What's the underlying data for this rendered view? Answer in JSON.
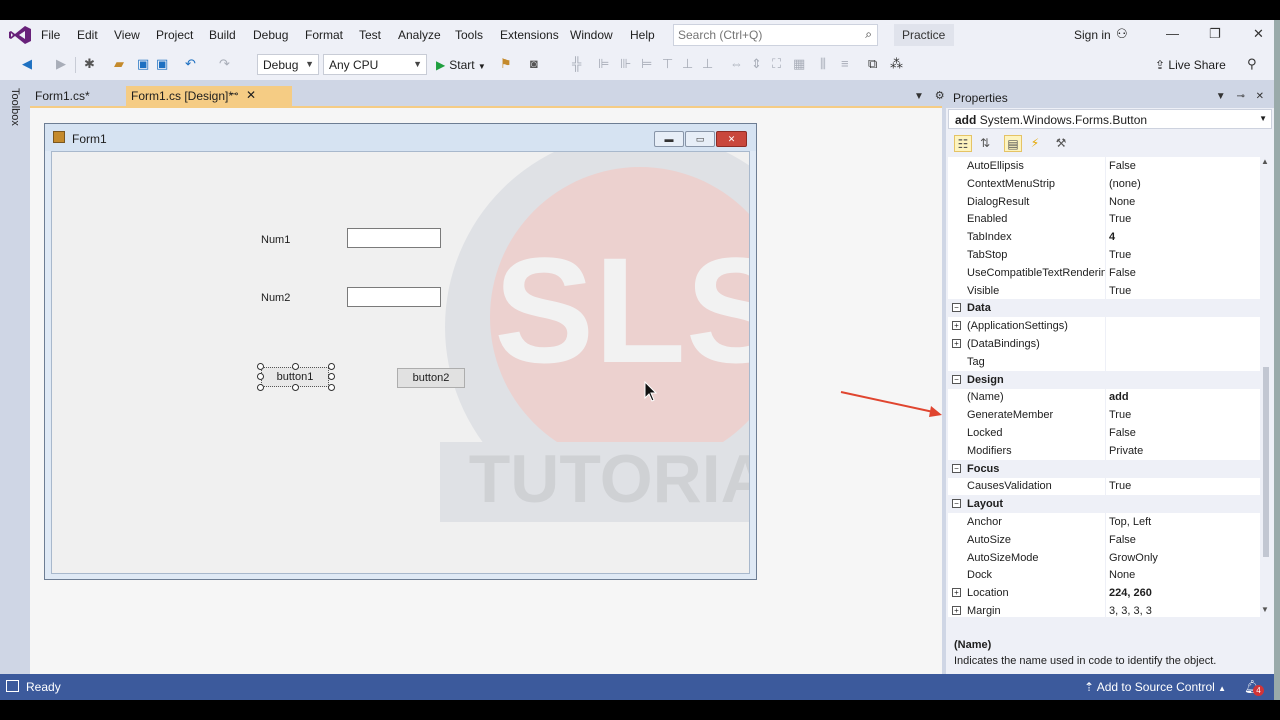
{
  "menu": {
    "items": [
      "File",
      "Edit",
      "View",
      "Project",
      "Build",
      "Debug",
      "Format",
      "Test",
      "Analyze",
      "Tools",
      "Extensions",
      "Window",
      "Help"
    ],
    "search_placeholder": "Search (Ctrl+Q)",
    "solution_name": "Practice",
    "sign_in": "Sign in"
  },
  "toolbar": {
    "config": "Debug",
    "platform": "Any CPU",
    "start": "Start",
    "live_share": "Live Share"
  },
  "toolbox_label": "Toolbox",
  "tabs": [
    {
      "label": "Form1.cs*"
    },
    {
      "label": "Form1.cs [Design]*"
    }
  ],
  "form": {
    "title": "Form1",
    "controls": {
      "label_num1": "Num1",
      "label_num2": "Num2",
      "button1": "button1",
      "button2": "button2"
    },
    "watermark": {
      "top": "SLS",
      "bottom": "TUTORIAL"
    }
  },
  "properties": {
    "header": "Properties",
    "object_name": "add",
    "object_type": "System.Windows.Forms.Button",
    "rows": [
      {
        "name": "AutoEllipsis",
        "value": "False"
      },
      {
        "name": "ContextMenuStrip",
        "value": "(none)"
      },
      {
        "name": "DialogResult",
        "value": "None"
      },
      {
        "name": "Enabled",
        "value": "True"
      },
      {
        "name": "TabIndex",
        "value": "4",
        "bold": true
      },
      {
        "name": "TabStop",
        "value": "True"
      },
      {
        "name": "UseCompatibleTextRendering",
        "value": "False"
      },
      {
        "name": "Visible",
        "value": "True"
      },
      {
        "name": "Data",
        "category": true
      },
      {
        "name": "(ApplicationSettings)",
        "value": "",
        "expand": true
      },
      {
        "name": "(DataBindings)",
        "value": "",
        "expand": true
      },
      {
        "name": "Tag",
        "value": ""
      },
      {
        "name": "Design",
        "category": true
      },
      {
        "name": "(Name)",
        "value": "add",
        "bold": true
      },
      {
        "name": "GenerateMember",
        "value": "True"
      },
      {
        "name": "Locked",
        "value": "False"
      },
      {
        "name": "Modifiers",
        "value": "Private"
      },
      {
        "name": "Focus",
        "category": true
      },
      {
        "name": "CausesValidation",
        "value": "True"
      },
      {
        "name": "Layout",
        "category": true
      },
      {
        "name": "Anchor",
        "value": "Top, Left"
      },
      {
        "name": "AutoSize",
        "value": "False"
      },
      {
        "name": "AutoSizeMode",
        "value": "GrowOnly"
      },
      {
        "name": "Dock",
        "value": "None"
      },
      {
        "name": "Location",
        "value": "224, 260",
        "bold": true,
        "expand": true
      },
      {
        "name": "Margin",
        "value": "3, 3, 3, 3",
        "expand": true
      }
    ],
    "description_title": "(Name)",
    "description_text": "Indicates the name used in code to identify the object."
  },
  "status": {
    "text": "Ready",
    "source_control": "Add to Source Control",
    "notifications_count": "4"
  },
  "colors": {
    "status_bar": "#3c5a9c",
    "active_tab": "#f5cc84",
    "annotation_arrow": "#e0452f"
  }
}
